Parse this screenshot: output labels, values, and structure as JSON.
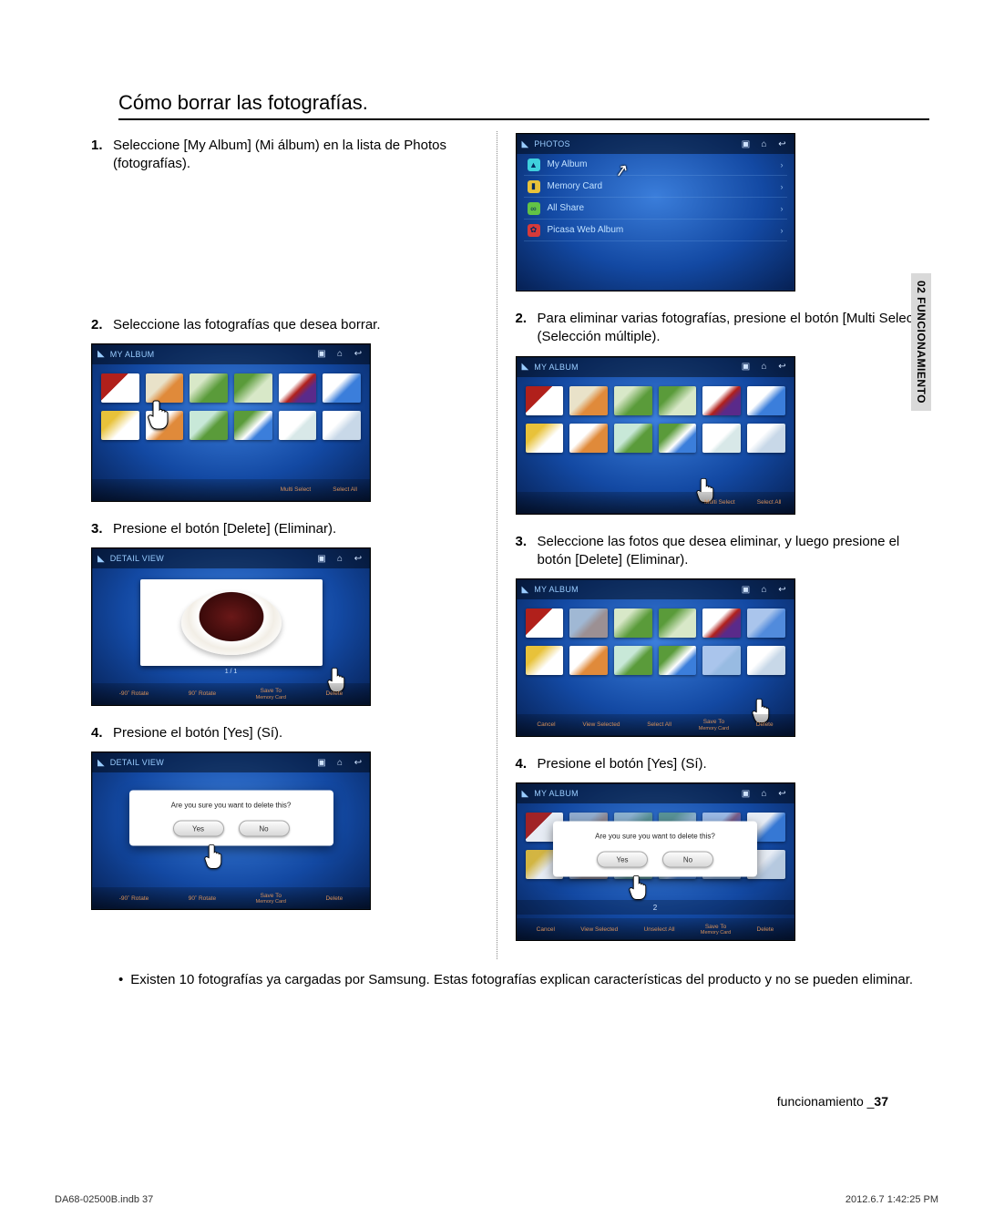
{
  "page": {
    "section_title": "Cómo borrar las fotografías.",
    "side_tab": "02  FUNCIONAMIENTO",
    "footer_label": "funcionamiento _",
    "footer_page": "37",
    "print_left": "DA68-02500B.indb   37",
    "print_right": "2012.6.7   1:42:25 PM",
    "bullet_note": "Existen 10 fotografías ya cargadas por Samsung. Estas fotografías explican características del producto y no se pueden eliminar."
  },
  "left": {
    "s1": {
      "num": "1.",
      "text": "Seleccione [My Album] (Mi álbum) en la lista de Photos (fotografías)."
    },
    "s2": {
      "num": "2.",
      "text": "Seleccione las fotografías que desea borrar."
    },
    "s3": {
      "num": "3.",
      "text": "Presione el botón [Delete] (Eliminar)."
    },
    "s4": {
      "num": "4.",
      "text": "Presione el botón [Yes] (Sí)."
    }
  },
  "right": {
    "s2": {
      "num": "2.",
      "text": "Para eliminar varias fotografías, presione el botón [Multi Select] (Selección múltiple)."
    },
    "s3": {
      "num": "3.",
      "text": "Seleccione las fotos que desea eliminar, y luego presione el botón [Delete] (Eliminar)."
    },
    "s4": {
      "num": "4.",
      "text": "Presione el botón [Yes] (Sí)."
    }
  },
  "topbar": {
    "photos": "PHOTOS",
    "my_album": "MY ALBUM",
    "detail": "DETAIL VIEW"
  },
  "photos_list": {
    "r1": "My Album",
    "r2": "Memory Card",
    "r3": "All Share",
    "r4": "Picasa Web Album"
  },
  "album_btm": {
    "multi": "Multi Select",
    "all": "Select All"
  },
  "detail_btm": {
    "rotL": "-90˚ Rotate",
    "rotR": "90˚ Rotate",
    "save": "Save To",
    "save2": "Memory Card",
    "del": "Delete"
  },
  "multi_btm": {
    "cancel": "Cancel",
    "view": "View Selected",
    "all": "Select All",
    "unall": "Unselect All",
    "save": "Save To",
    "save2": "Memory Card",
    "del": "Delete"
  },
  "dialog": {
    "msg": "Are you sure you want to delete this?",
    "yes": "Yes",
    "no": "No"
  },
  "pager": "1 / 1",
  "dots_value": "2"
}
